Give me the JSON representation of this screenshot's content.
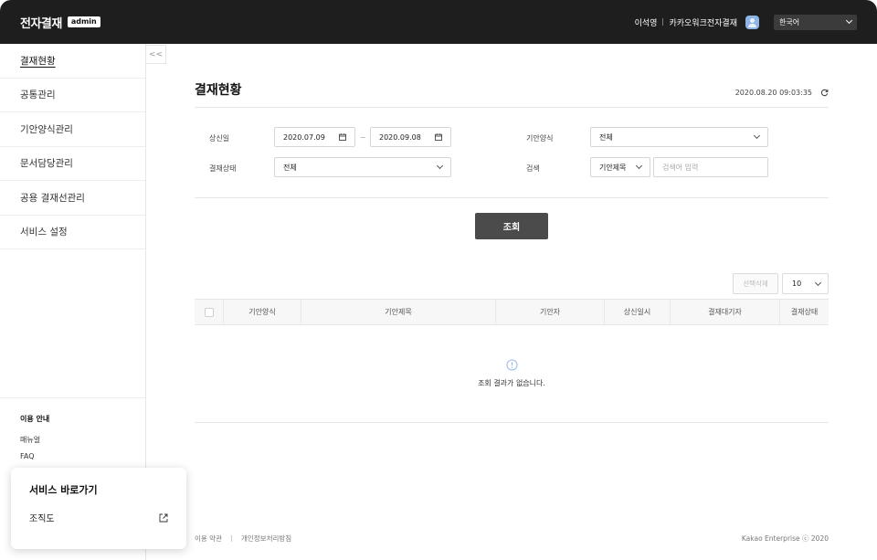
{
  "header": {
    "logo": "전자결재",
    "badge": "admin",
    "user_name": "이석영",
    "company": "카카오워크전자결재",
    "language": "한국어"
  },
  "sidebar": {
    "items": [
      {
        "label": "결재현황",
        "active": true
      },
      {
        "label": "공통관리",
        "active": false
      },
      {
        "label": "기안양식관리",
        "active": false
      },
      {
        "label": "문서담당관리",
        "active": false
      },
      {
        "label": "공용 결재선관리",
        "active": false
      },
      {
        "label": "서비스 설정",
        "active": false
      }
    ],
    "collapse_label": "<<",
    "guide": {
      "title": "이용 안내",
      "links": [
        "매뉴얼",
        "FAQ"
      ]
    }
  },
  "popup": {
    "title": "서비스 바로가기",
    "item": "조직도"
  },
  "main": {
    "title": "결재현황",
    "timestamp": "2020.08.20  09:03:35",
    "filters": {
      "date_label": "상신일",
      "date_from": "2020.07.09",
      "date_sep": "~",
      "date_to": "2020.09.08",
      "form_label": "기안양식",
      "form_value": "전체",
      "status_label": "결재상태",
      "status_value": "전체",
      "search_label": "검색",
      "search_type": "기안제목",
      "search_placeholder": "검색어 입력"
    },
    "search_button": "조회",
    "delete_button": "선택삭제",
    "page_size": "10",
    "columns": [
      "기안양식",
      "기안제목",
      "기안자",
      "상신일시",
      "결재대기자",
      "결재상태"
    ],
    "empty_message": "조회 결과가 없습니다."
  },
  "footer": {
    "terms": "이용 약관",
    "privacy": "개인정보처리방침",
    "copyright": "Kakao Enterprise  ⓒ 2020"
  },
  "colors": {
    "header_bg": "#1e1e1e",
    "primary_button": "#4b4b4b",
    "info_icon": "#8fb4e6"
  }
}
